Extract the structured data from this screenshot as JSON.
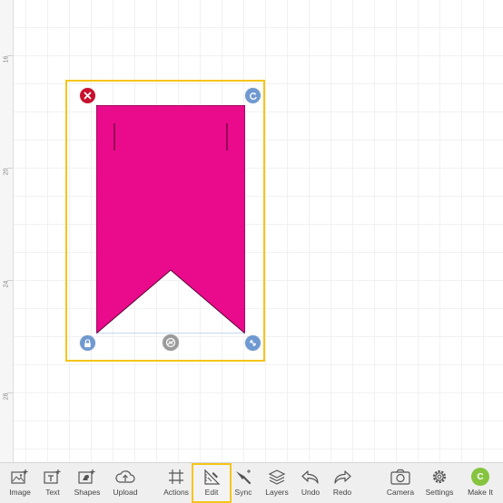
{
  "ruler": {
    "labels": [
      "16",
      "20",
      "24",
      "28"
    ]
  },
  "colors": {
    "shape_fill": "#ea0a8c",
    "selection_border": "#f5c518",
    "delete_handle": "#c8102e",
    "blue_handle": "#6f99d0",
    "makeit": "#86c440"
  },
  "canvas": {
    "selected_shape": "banner-flag"
  },
  "toolbar": {
    "items": [
      {
        "label": "Image",
        "icon": "image-add-icon"
      },
      {
        "label": "Text",
        "icon": "text-add-icon"
      },
      {
        "label": "Shapes",
        "icon": "shapes-icon"
      },
      {
        "label": "Upload",
        "icon": "upload-cloud-icon"
      },
      {
        "label": "Actions",
        "icon": "actions-icon"
      },
      {
        "label": "Edit",
        "icon": "edit-ruler-icon",
        "active": true
      },
      {
        "label": "Sync",
        "icon": "sync-brush-icon"
      },
      {
        "label": "Layers",
        "icon": "layers-icon"
      },
      {
        "label": "Undo",
        "icon": "undo-icon"
      },
      {
        "label": "Redo",
        "icon": "redo-icon"
      },
      {
        "label": "Camera",
        "icon": "camera-icon"
      },
      {
        "label": "Settings",
        "icon": "settings-gear-icon"
      },
      {
        "label": "Make It",
        "icon": "make-it-icon",
        "badge": "C"
      }
    ]
  }
}
